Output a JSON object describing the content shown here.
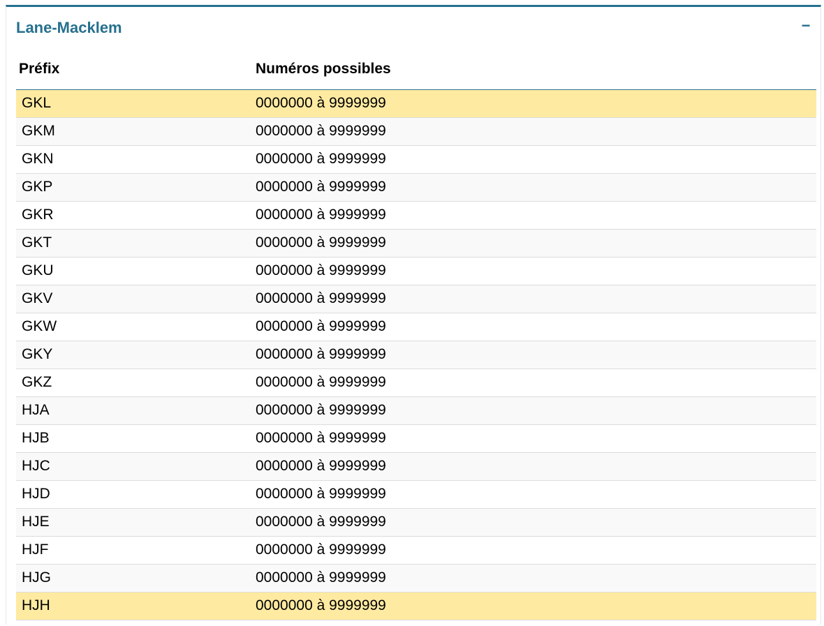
{
  "panel": {
    "title": "Lane-Macklem",
    "collapse_label": "−",
    "accent_color": "#26708e",
    "highlight_color": "#ffeaa1"
  },
  "table": {
    "headers": {
      "prefix": "Préfix",
      "numbers": "Numéros possibles"
    },
    "rows": [
      {
        "prefix": "GKL",
        "numbers": "0000000 à 9999999",
        "highlighted": true
      },
      {
        "prefix": "GKM",
        "numbers": "0000000 à 9999999",
        "highlighted": false
      },
      {
        "prefix": "GKN",
        "numbers": "0000000 à 9999999",
        "highlighted": false
      },
      {
        "prefix": "GKP",
        "numbers": "0000000 à 9999999",
        "highlighted": false
      },
      {
        "prefix": "GKR",
        "numbers": "0000000 à 9999999",
        "highlighted": false
      },
      {
        "prefix": "GKT",
        "numbers": "0000000 à 9999999",
        "highlighted": false
      },
      {
        "prefix": "GKU",
        "numbers": "0000000 à 9999999",
        "highlighted": false
      },
      {
        "prefix": "GKV",
        "numbers": "0000000 à 9999999",
        "highlighted": false
      },
      {
        "prefix": "GKW",
        "numbers": "0000000 à 9999999",
        "highlighted": false
      },
      {
        "prefix": "GKY",
        "numbers": "0000000 à 9999999",
        "highlighted": false
      },
      {
        "prefix": "GKZ",
        "numbers": "0000000 à 9999999",
        "highlighted": false
      },
      {
        "prefix": "HJA",
        "numbers": "0000000 à 9999999",
        "highlighted": false
      },
      {
        "prefix": "HJB",
        "numbers": "0000000 à 9999999",
        "highlighted": false
      },
      {
        "prefix": "HJC",
        "numbers": "0000000 à 9999999",
        "highlighted": false
      },
      {
        "prefix": "HJD",
        "numbers": "0000000 à 9999999",
        "highlighted": false
      },
      {
        "prefix": "HJE",
        "numbers": "0000000 à 9999999",
        "highlighted": false
      },
      {
        "prefix": "HJF",
        "numbers": "0000000 à 9999999",
        "highlighted": false
      },
      {
        "prefix": "HJG",
        "numbers": "0000000 à 9999999",
        "highlighted": false
      },
      {
        "prefix": "HJH",
        "numbers": "0000000 à 9999999",
        "highlighted": true
      }
    ]
  }
}
